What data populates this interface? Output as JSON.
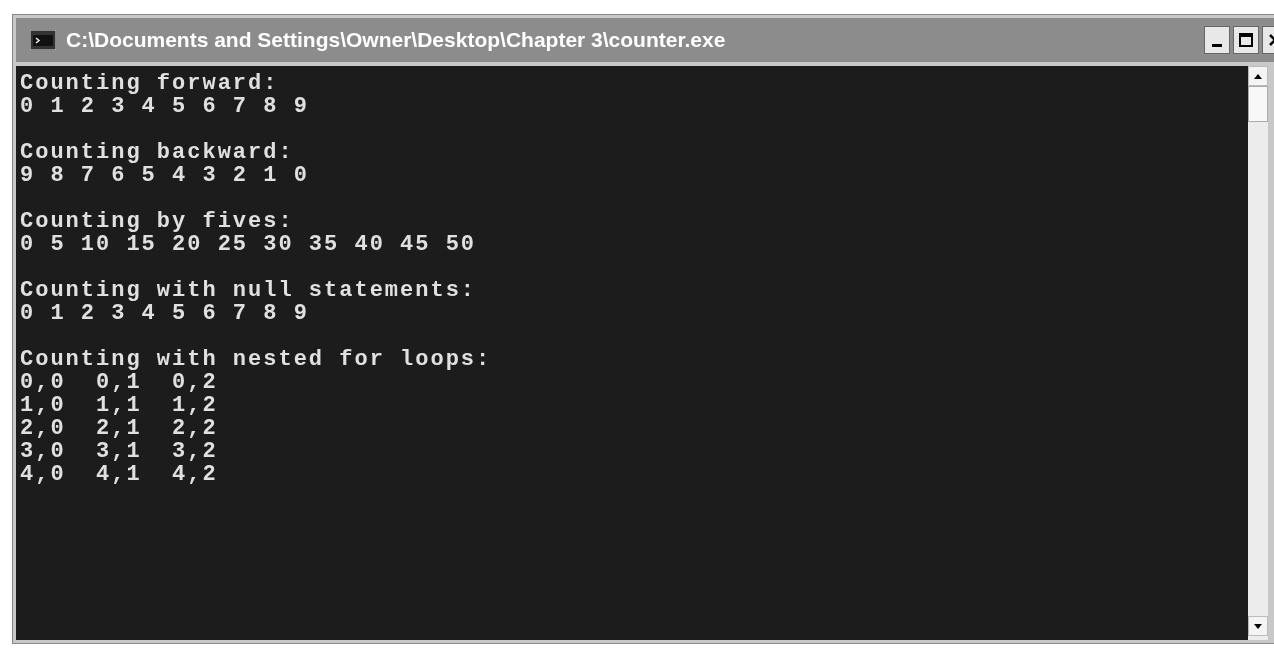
{
  "window": {
    "title": "C:\\Documents and Settings\\Owner\\Desktop\\Chapter 3\\counter.exe"
  },
  "console": {
    "sections": [
      {
        "heading": "Counting forward:",
        "lines": [
          "0 1 2 3 4 5 6 7 8 9"
        ]
      },
      {
        "heading": "Counting backward:",
        "lines": [
          "9 8 7 6 5 4 3 2 1 0"
        ]
      },
      {
        "heading": "Counting by fives:",
        "lines": [
          "0 5 10 15 20 25 30 35 40 45 50"
        ]
      },
      {
        "heading": "Counting with null statements:",
        "lines": [
          "0 1 2 3 4 5 6 7 8 9"
        ]
      },
      {
        "heading": "Counting with nested for loops:",
        "lines": [
          "0,0  0,1  0,2",
          "1,0  1,1  1,2",
          "2,0  2,1  2,2",
          "3,0  3,1  3,2",
          "4,0  4,1  4,2"
        ]
      }
    ]
  }
}
